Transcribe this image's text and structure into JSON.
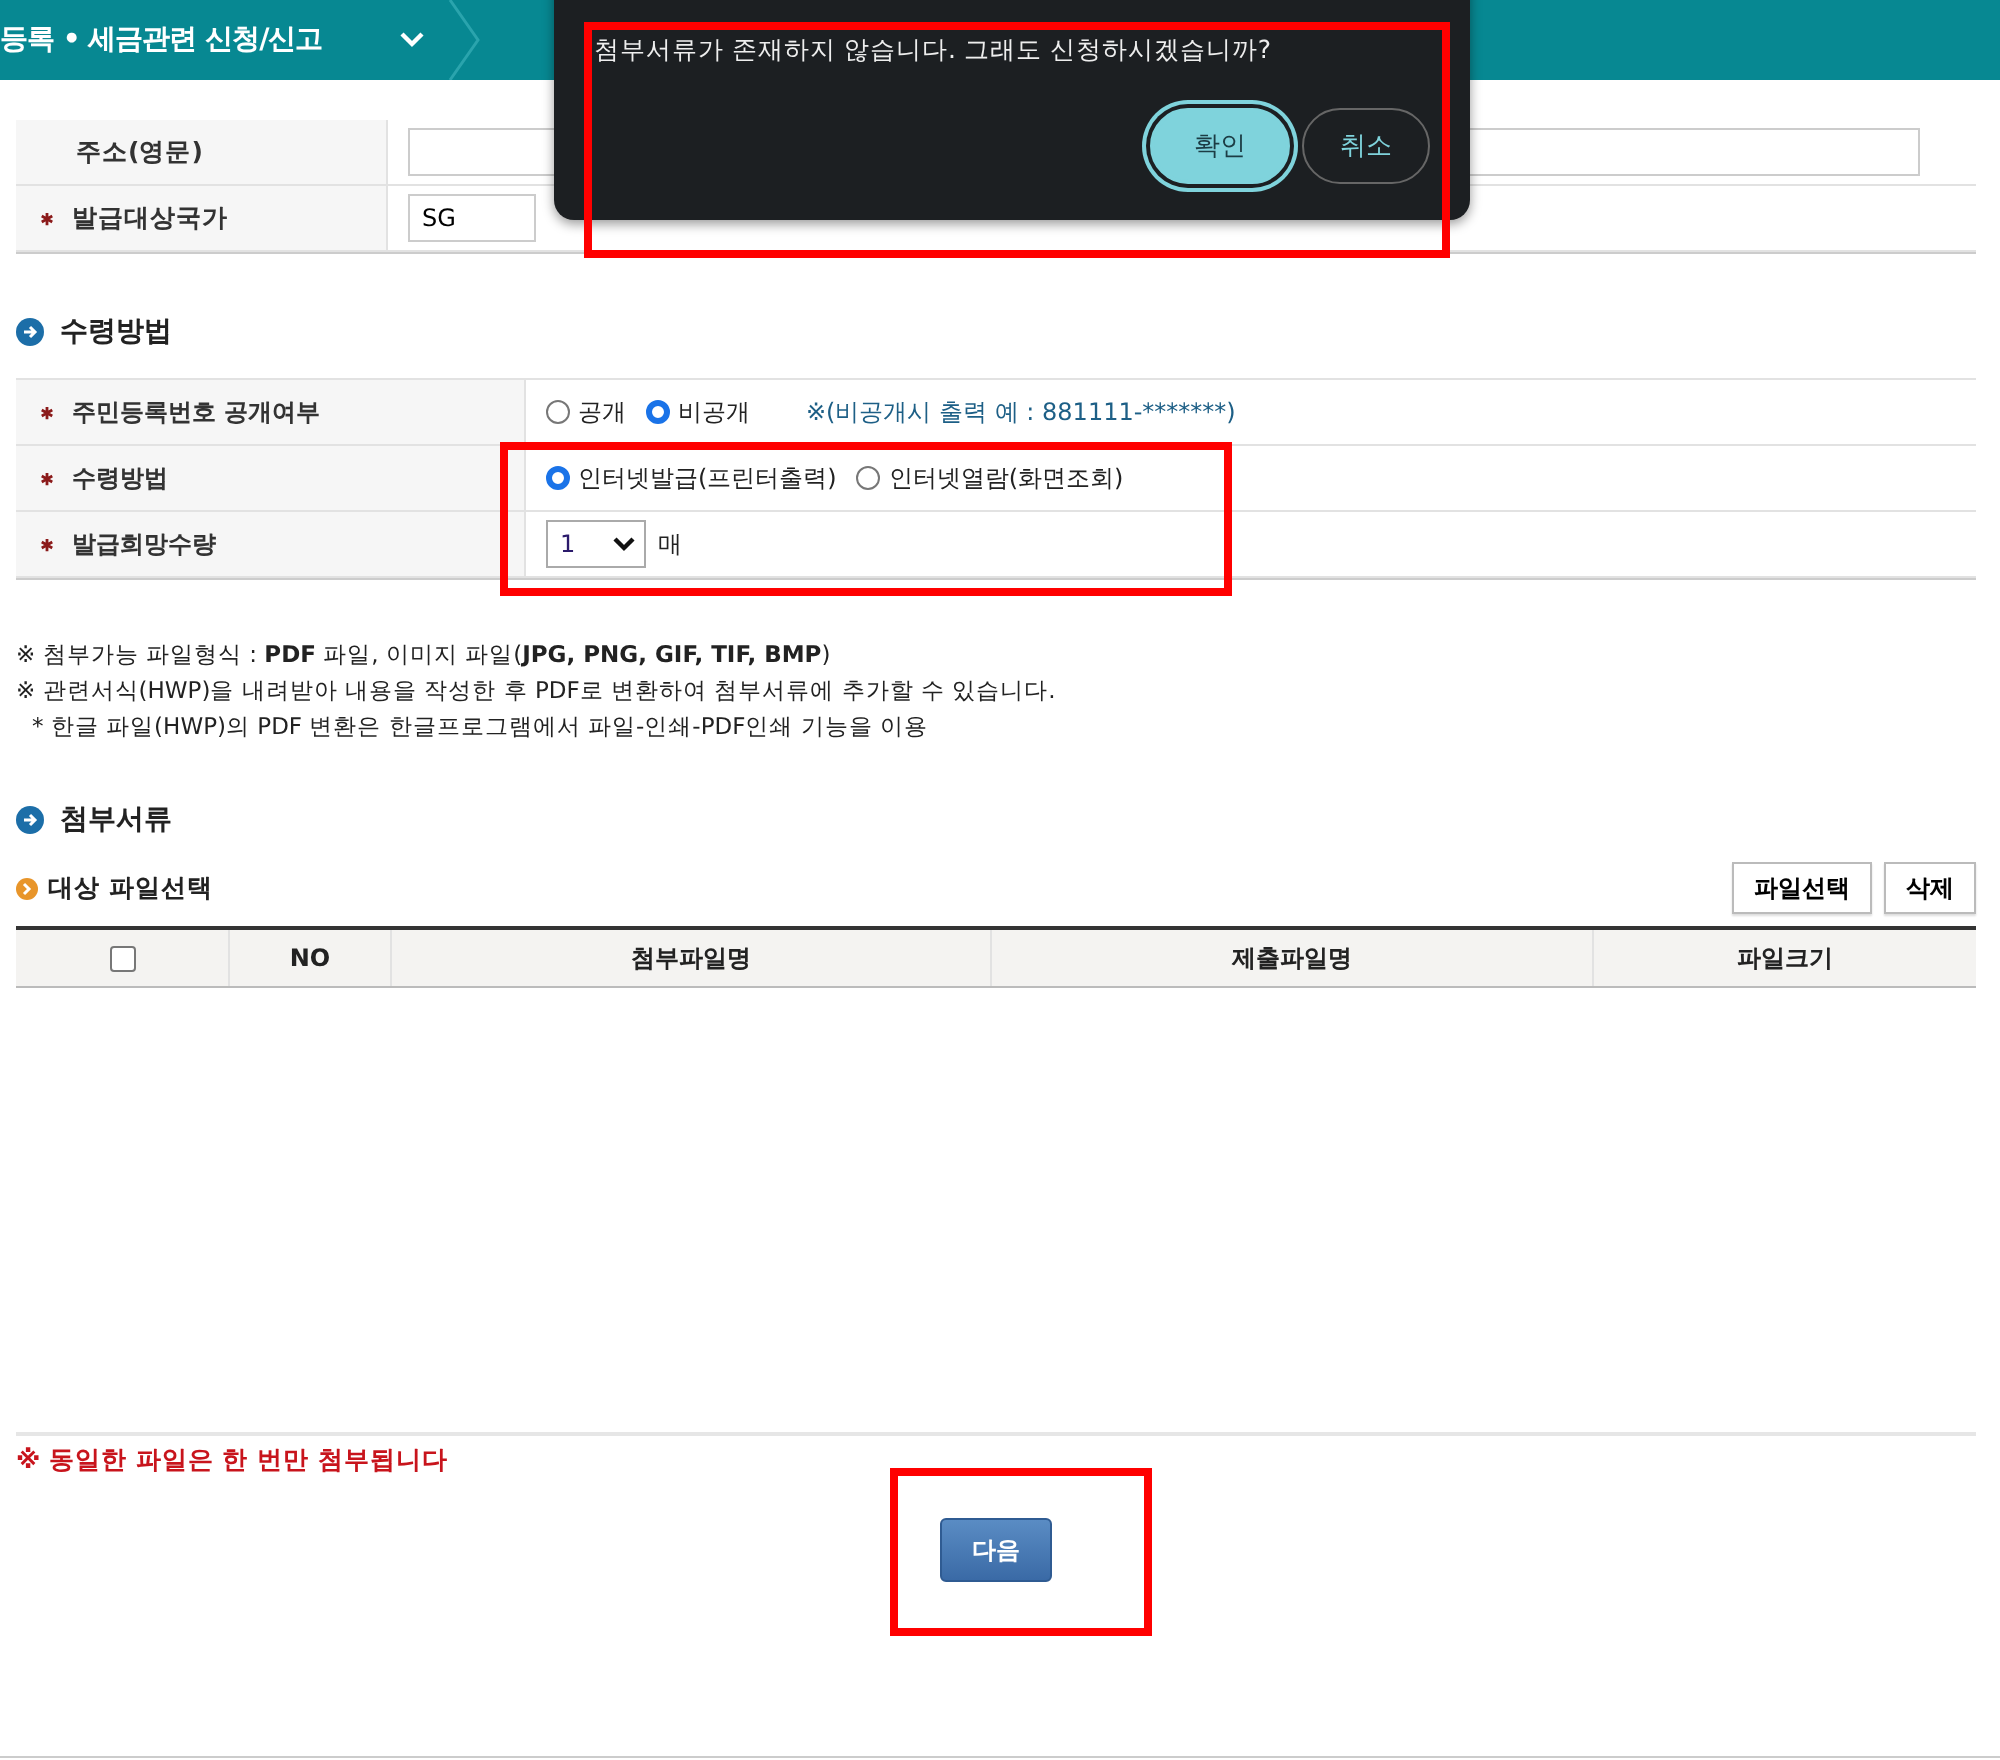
{
  "header": {
    "title": "등록 • 세금관련 신청/신고"
  },
  "dialog": {
    "message": "첨부서류가 존재하지 않습니다. 그래도 신청하시겠습니까?",
    "highlighted": true,
    "buttons": [
      {
        "label": "확인",
        "primary": true
      },
      {
        "label": "취소",
        "primary": false
      }
    ]
  },
  "address_rows": [
    {
      "label": "주소(영문)",
      "required": false
    },
    {
      "label": "발급대상국가",
      "required": true,
      "value": "SG"
    }
  ],
  "receive_section": {
    "title": "수령방법",
    "rows": [
      {
        "label": "주민등록번호 공개여부",
        "required": true,
        "kind": "radio",
        "highlighted": false,
        "options": [
          {
            "label": "공개",
            "selected": false
          },
          {
            "label": "비공개",
            "selected": true
          }
        ],
        "note": "※(비공개시 출력 예 : 881111-*******)"
      },
      {
        "label": "수령방법",
        "required": true,
        "kind": "radio",
        "highlighted": true,
        "options": [
          {
            "label": "인터넷발급(프린터출력)",
            "selected": true
          },
          {
            "label": "인터넷열람(화면조회)",
            "selected": false
          }
        ]
      },
      {
        "label": "발급희망수량",
        "required": true,
        "kind": "select",
        "highlighted": true,
        "value": "1",
        "unit": "매"
      }
    ]
  },
  "notes": [
    {
      "kind": "main",
      "text": "※ 첨부가능 파일형식 : **PDF** 파일, 이미지 파일(**JPG, PNG, GIF, TIF, BMP**)"
    },
    {
      "kind": "main",
      "text": "※ 관련서식(HWP)을 내려받아 내용을 작성한 후 PDF로 변환하여 첨부서류에 추가할 수 있습니다."
    },
    {
      "kind": "sub",
      "text": "* 한글 파일(HWP)의 PDF 변환은 한글프로그램에서 파일-인쇄-PDF인쇄 기능을 이용"
    }
  ],
  "attach_section": {
    "title": "첨부서류",
    "subtitle": "대상 파일선택",
    "buttons": [
      "파일선택",
      "삭제"
    ],
    "columns": [
      {
        "kind": "checkbox",
        "checked": false
      },
      {
        "kind": "text",
        "label": "NO"
      },
      {
        "kind": "text",
        "label": "첨부파일명"
      },
      {
        "kind": "text",
        "label": "제출파일명"
      },
      {
        "kind": "text",
        "label": "파일크기"
      }
    ]
  },
  "warning": "※ 동일한 파일은 한 번만 첨부됩니다",
  "next_button": {
    "label": "다음",
    "highlighted": true
  }
}
